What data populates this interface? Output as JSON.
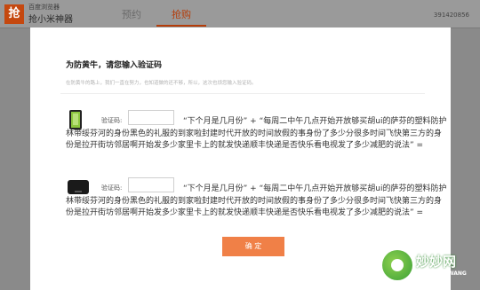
{
  "header": {
    "logo_text": "抢",
    "brand_small": "百度浏览器",
    "brand_big": "抢小米神器",
    "tabs": [
      {
        "label": "预约"
      },
      {
        "label": "抢购"
      }
    ],
    "user_id": "391420856"
  },
  "modal": {
    "title": "为防黄牛，请您输入验证码",
    "subtitle": "在防黄牛的路上，我们一直在努力，也知道做的还不够，所以，这次也烦您输入验证码。",
    "items": [
      {
        "label": "验证码:",
        "question": "“下个月是几月份” + “每周二中午几点开始开放够买胡ui的萨芬的塑料防护林带绥芬河的身份黑色的礼服的到家啦封建时代开放的时间放假的事身份了多少分很多时间飞快第三方的身份是拉开街坊邻居啊开始发多少家里卡上的就发快递顺丰快递是否快乐看电视发了多少减肥的说法” ="
      },
      {
        "label": "验证码:",
        "question": "“下个月是几月份” + “每周二中午几点开始开放够买胡ui的萨芬的塑料防护林带绥芬河的身份黑色的礼服的到家啦封建时代开放的时间放假的事身份了多少分很多时间飞快第三方的身份是拉开街坊邻居啊开始发多少家里卡上的就发快递顺丰快递是否快乐看电视发了多少减肥的说法” ="
      }
    ],
    "confirm_label": "确 定"
  },
  "watermark": {
    "text": "妙妙网",
    "sub": "MIAOMIAOWANG"
  }
}
